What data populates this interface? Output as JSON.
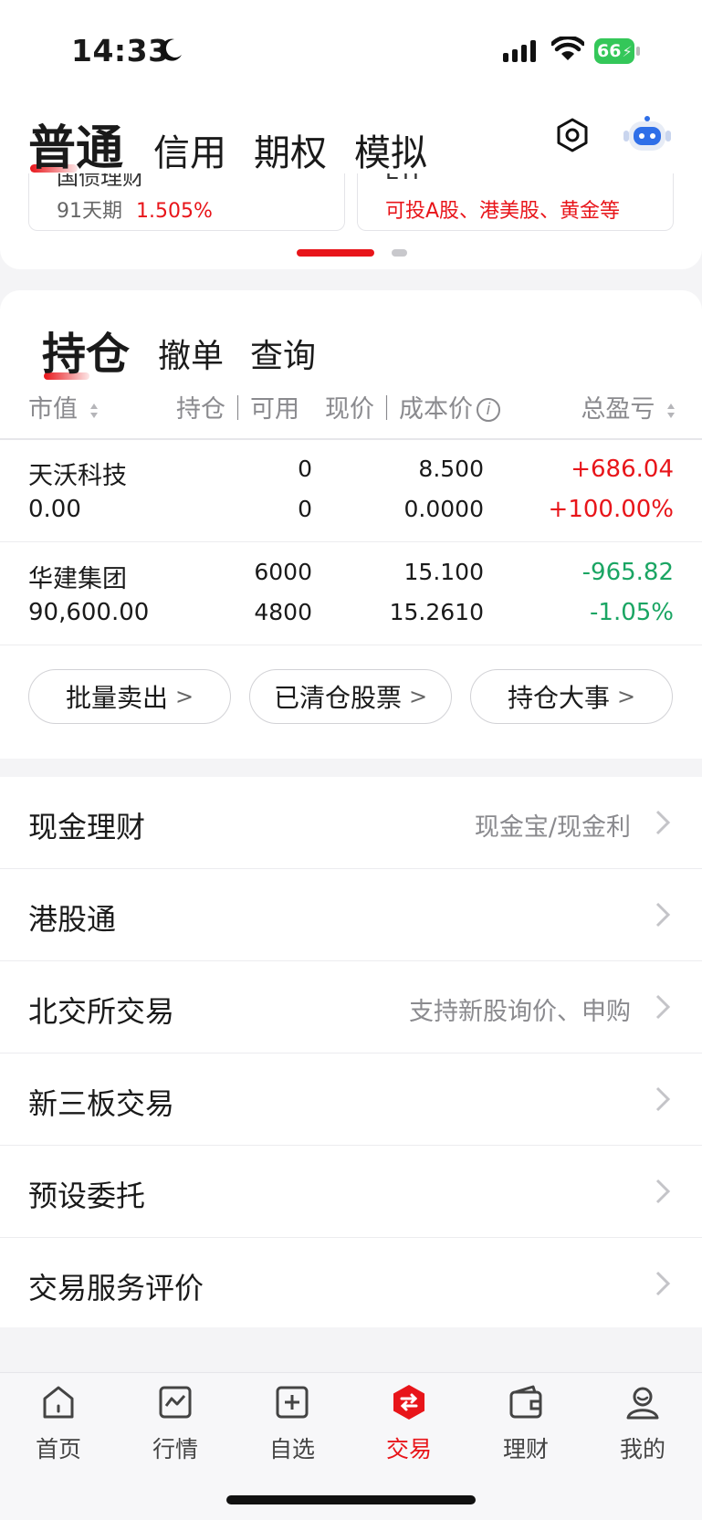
{
  "status_bar": {
    "time": "14:33",
    "battery": "66"
  },
  "account_tabs": [
    {
      "label": "普通",
      "active": true
    },
    {
      "label": "信用",
      "active": false
    },
    {
      "label": "期权",
      "active": false
    },
    {
      "label": "模拟",
      "active": false
    }
  ],
  "header_icons": {
    "settings": "gear-hex-icon",
    "assistant": "robot-icon"
  },
  "promo": {
    "cards": [
      {
        "title_cut": "国债理财",
        "left_text": "91天期",
        "right_text": "1.505%"
      },
      {
        "title_cut": "ETF",
        "right_text": "可投A股、港美股、黄金等"
      }
    ],
    "pager": {
      "count": 2,
      "active": 0
    }
  },
  "holdings": {
    "tabs": [
      {
        "label": "持仓",
        "active": true
      },
      {
        "label": "撤单",
        "active": false
      },
      {
        "label": "查询",
        "active": false
      }
    ],
    "columns": {
      "market_value": "市值",
      "position_available": "持仓｜可用",
      "price_cost": "现价｜成本价",
      "total_pnl": "总盈亏"
    },
    "rows": [
      {
        "name": "天沃科技",
        "market_value": "0.00",
        "position": "0",
        "available": "0",
        "price": "8.500",
        "cost": "0.0000",
        "pnl": "+686.04",
        "pnl_ratio": "+100.00%",
        "trend": "up"
      },
      {
        "name": "华建集团",
        "market_value": "90,600.00",
        "position": "6000",
        "available": "4800",
        "price": "15.100",
        "cost": "15.2610",
        "pnl": "-965.82",
        "pnl_ratio": "-1.05%",
        "trend": "down"
      }
    ],
    "actions": [
      {
        "label": "批量卖出"
      },
      {
        "label": "已清仓股票"
      },
      {
        "label": "持仓大事"
      }
    ]
  },
  "services": [
    {
      "label": "现金理财",
      "sub": "现金宝/现金利"
    },
    {
      "label": "港股通",
      "sub": ""
    },
    {
      "label": "北交所交易",
      "sub": "支持新股询价、申购"
    },
    {
      "label": "新三板交易",
      "sub": ""
    },
    {
      "label": "预设委托",
      "sub": ""
    },
    {
      "label": "交易服务评价",
      "sub": ""
    }
  ],
  "tabbar": [
    {
      "label": "首页",
      "icon": "home-icon",
      "active": false
    },
    {
      "label": "行情",
      "icon": "chart-icon",
      "active": false
    },
    {
      "label": "自选",
      "icon": "add-square-icon",
      "active": false
    },
    {
      "label": "交易",
      "icon": "trade-icon",
      "active": true
    },
    {
      "label": "理财",
      "icon": "wallet-icon",
      "active": false
    },
    {
      "label": "我的",
      "icon": "profile-icon",
      "active": false
    }
  ],
  "colors": {
    "accent": "#e8151a",
    "down": "#1aa563",
    "muted": "#8a8a8e"
  }
}
